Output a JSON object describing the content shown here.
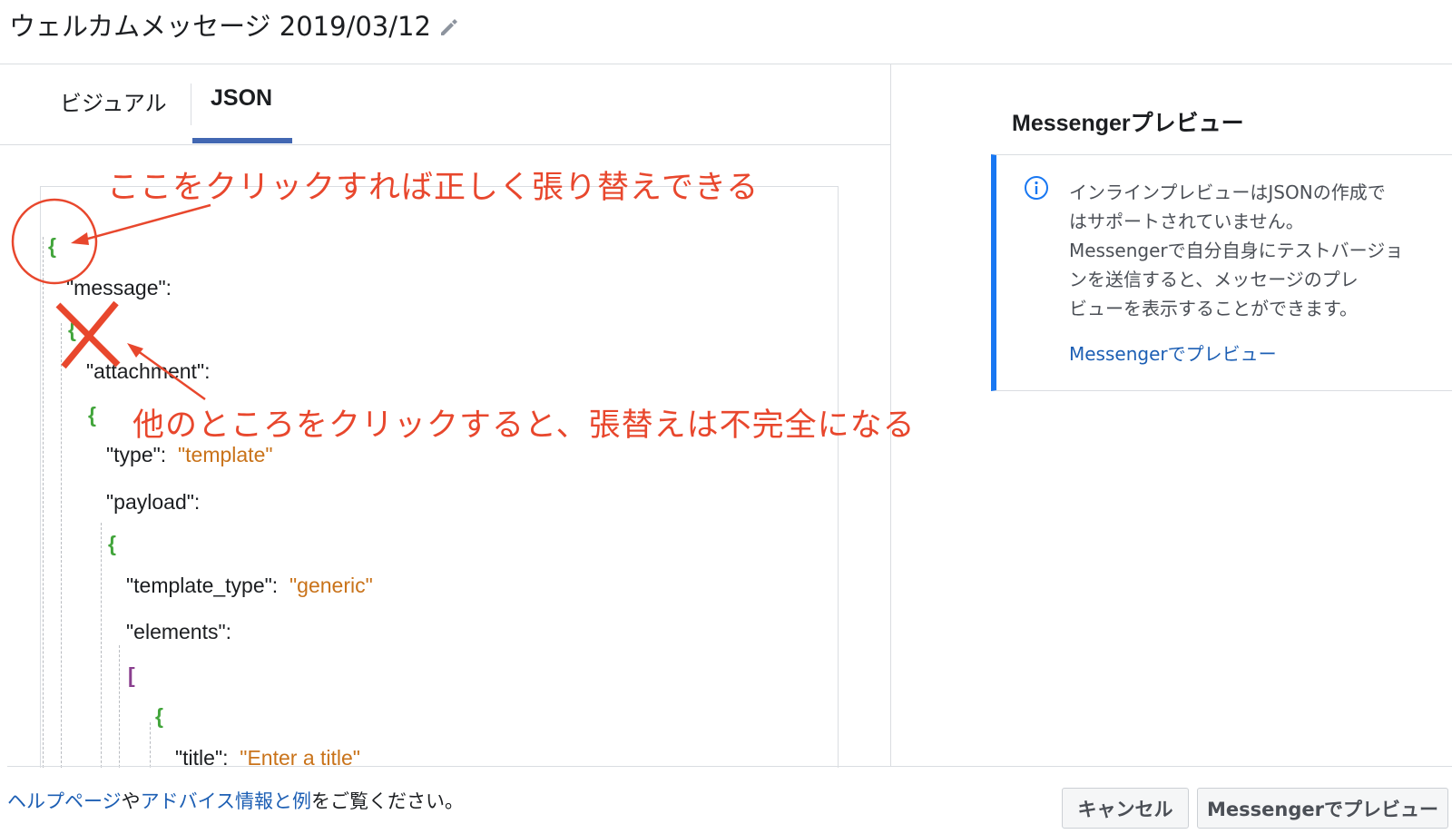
{
  "header": {
    "title": "ウェルカムメッセージ 2019/03/12",
    "edit_icon": "pencil-icon"
  },
  "tabs": [
    {
      "label": "ビジュアル",
      "active": false
    },
    {
      "label": "JSON",
      "active": true
    }
  ],
  "editor": {
    "lines": {
      "l1": "{",
      "l2_key": "\"message\":",
      "l3": "{",
      "l4_key": "\"attachment\":",
      "l5": "{",
      "l6_key": "\"type\":",
      "l6_val": "\"template\"",
      "l7_key": "\"payload\":",
      "l8": "{",
      "l9_key": "\"template_type\":",
      "l9_val": "\"generic\"",
      "l10_key": "\"elements\":",
      "l11": "[",
      "l12": "{",
      "l13_key": "\"title\":",
      "l13_val": "\"Enter a title\""
    }
  },
  "annotations": {
    "top_note": "ここをクリックすれば正しく張り替えできる",
    "bottom_note": "他のところをクリックすると、張替えは不完全になる",
    "color": "#e8472d"
  },
  "preview": {
    "title": "Messengerプレビュー",
    "info_icon": "info-icon",
    "info_lines": [
      "インラインプレビューはJSONの作成で",
      "はサポートされていません。",
      "Messengerで自分自身にテストバージョ",
      "ンを送信すると、メッセージのプレ",
      "ビューを表示することができます。"
    ],
    "link": "Messengerでプレビュー",
    "accent": "#1877f2"
  },
  "footer": {
    "help_link": "ヘルプページ",
    "help_mid": "や",
    "advice_link": "アドバイス情報と例",
    "help_end": "をご覧ください。",
    "cancel": "キャンセル",
    "preview_button": "Messengerでプレビュー"
  }
}
